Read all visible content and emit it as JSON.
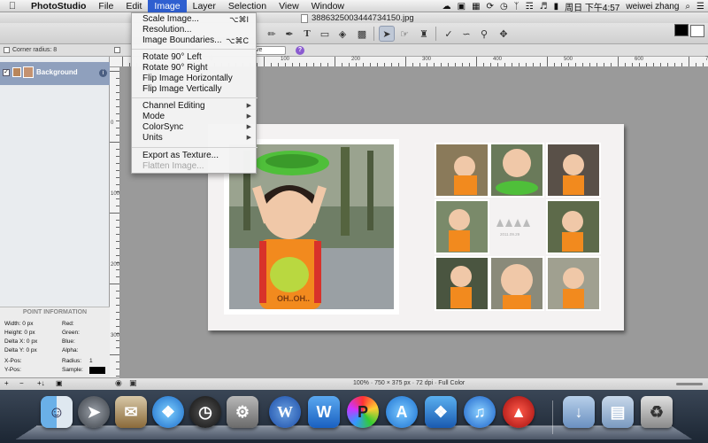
{
  "menubar": {
    "app_name": "PhotoStudio",
    "items": [
      "File",
      "Edit",
      "Image",
      "Layer",
      "Selection",
      "View",
      "Window"
    ],
    "active_item": "Image",
    "status": {
      "datetime": "周日 下午4:57",
      "user": "weiwei zhang"
    }
  },
  "window": {
    "title": "3886325003444734150.jpg"
  },
  "options_bar": {
    "corner_radius_label": "Corner radius: 8",
    "blend_value": "ve"
  },
  "layers": {
    "items": [
      {
        "label": "Background"
      }
    ]
  },
  "point_info": {
    "title": "POINT INFORMATION",
    "width": "Width:   0 px",
    "height": "Height:  0 px",
    "delta_x": "Delta X: 0 px",
    "delta_y": "Delta Y: 0 px",
    "x_pos": "X-Pos:",
    "y_pos": "Y-Pos:",
    "red": "Red:",
    "green": "Green:",
    "blue": "Blue:",
    "alpha": "Alpha:",
    "radius": "Radius:",
    "radius_value": "1",
    "sample": "Sample:"
  },
  "status_bar": {
    "info": "100% · 750 × 375 px · 72 dpi · Full Color"
  },
  "image_menu": {
    "items": [
      {
        "label": "Scale Image...",
        "shortcut": "⌥⌘I",
        "enabled": true
      },
      {
        "label": "Resolution...",
        "shortcut": "",
        "enabled": true
      },
      {
        "label": "Image Boundaries...",
        "shortcut": "⌥⌘C",
        "enabled": true
      },
      {
        "label": "Rotate 90° Left",
        "enabled": true
      },
      {
        "label": "Rotate 90° Right",
        "enabled": true
      },
      {
        "label": "Flip Image Horizontally",
        "enabled": true
      },
      {
        "label": "Flip Image Vertically",
        "enabled": true
      },
      {
        "label": "Channel Editing",
        "submenu": true,
        "enabled": true
      },
      {
        "label": "Mode",
        "submenu": true,
        "enabled": true
      },
      {
        "label": "ColorSync",
        "submenu": true,
        "enabled": true
      },
      {
        "label": "Units",
        "submenu": true,
        "enabled": true
      },
      {
        "label": "Export as Texture...",
        "enabled": true
      },
      {
        "label": "Flatten Image...",
        "enabled": false
      }
    ]
  },
  "ruler": {
    "top": [
      "0",
      "100",
      "200",
      "300",
      "400",
      "500",
      "600",
      "700"
    ],
    "left": [
      "0",
      "100",
      "200",
      "300"
    ]
  },
  "canvas": {
    "collage_caption": "2011.09.29"
  },
  "colors": {
    "menu_highlight": "#2f5fd0",
    "foreground": "#000000",
    "background": "#ffffff"
  },
  "dock": {
    "icons": [
      "finder-icon",
      "launchpad-icon",
      "mail-icon",
      "safari-icon",
      "dashboard-icon",
      "system-preferences-icon",
      "word-icon",
      "wps-icon",
      "photostudio-icon",
      "app-store-icon",
      "dropbox-icon",
      "itunes-icon",
      "acrobat-icon",
      "downloads-icon",
      "documents-icon",
      "trash-icon"
    ]
  }
}
